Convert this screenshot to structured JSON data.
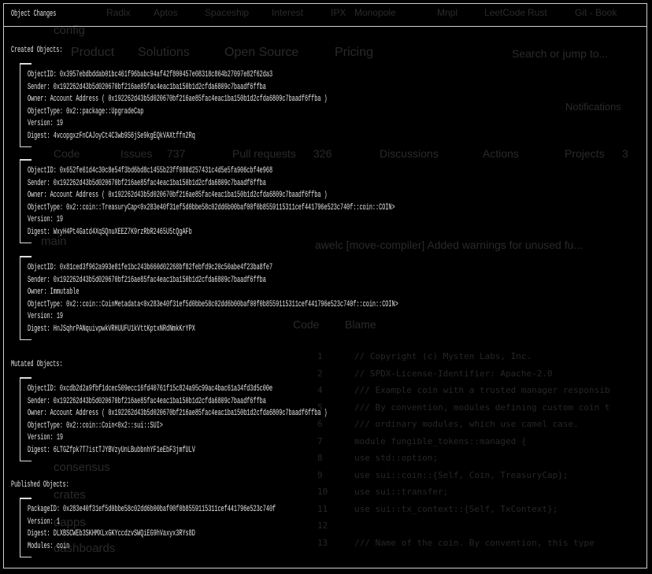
{
  "background": {
    "bookmarks": [
      "Radix",
      "Aptos",
      "Spaceship",
      "Interest",
      "IPX",
      "Monopole",
      "Mnpl",
      "LeetCode",
      "Rust",
      "Git - Book"
    ],
    "nav": [
      "Product",
      "Solutions",
      "Open Source",
      "Pricing"
    ],
    "search_placeholder": "Search or jump to...",
    "notifications": "Notifications",
    "tabs": [
      "Code",
      "Issues",
      "737",
      "Pull requests",
      "326",
      "Discussions",
      "Actions",
      "Projects",
      "3"
    ],
    "branch": "main",
    "commit": "awelc  [move-compiler] Added warnings for unused fu...",
    "code_tabs": [
      "Code",
      "Blame"
    ],
    "files": [
      "config",
      "consensus",
      "crates",
      "dapps",
      "dashboards"
    ],
    "code_lines": [
      {
        "n": "1",
        "t": "// Copyright (c) Mysten Labs, Inc."
      },
      {
        "n": "2",
        "t": "// SPDX-License-Identifier: Apache-2.0"
      },
      {
        "n": "4",
        "t": "/// Example coin with a trusted manager responsib"
      },
      {
        "n": "5",
        "t": "/// By convention, modules defining custom coin t"
      },
      {
        "n": "6",
        "t": "/// ordinary modules, which use camel case."
      },
      {
        "n": "7",
        "t": "module fungible_tokens::managed {"
      },
      {
        "n": "8",
        "t": "    use std::option;"
      },
      {
        "n": "9",
        "t": "    use sui::coin::{Self, Coin, TreasuryCap};"
      },
      {
        "n": "10",
        "t": "    use sui::transfer;"
      },
      {
        "n": "11",
        "t": "    use sui::tx_context::{Self, TxContext};"
      },
      {
        "n": "12",
        "t": ""
      },
      {
        "n": "13",
        "t": "    /// Name of the coin. By convention, this type"
      }
    ]
  },
  "title": "Object Changes",
  "sections": {
    "created_label": "Created Objects:",
    "mutated_label": "Mutated Objects:",
    "published_label": "Published Objects:"
  },
  "created": [
    [
      "ObjectID: 0x3957ebdbddab01bc461f96babc94af42f800457e08318c864b27097e82f62da3",
      "Sender: 0x192262d43b5d020670bf216ae85fac4eac1ba150b1d2cfda6809c7baadf6ffba",
      "Owner: Account Address ( 0x192262d43b5d020670bf216ae85fac4eac1ba150b1d2cfda6809c7baadf6ffba )",
      "ObjectType: 0x2::package::UpgradeCap",
      "Version: 19",
      "Digest: 4vcopgxzFnCAJoyCt4C3wb9S6jSe9kgEQkVAXtffn2Rq"
    ],
    [
      "ObjectID: 0x652fe61d4c30c8e54f3bd6bd8c1455b23ff088d257431c4d5e5fa906cbf4e968",
      "Sender: 0x192262d43b5d020670bf216ae85fac4eac1ba150b1d2cfda6809c7baadf6ffba",
      "Owner: Account Address ( 0x192262d43b5d020670bf216ae85fac4eac1ba150b1d2cfda6809c7baadf6ffba )",
      "ObjectType: 0x2::coin::TreasuryCap<0x283e40f31ef5d0bbe58c02dd6b00baf00f0b8559115311cef441796e523c740f::coin::COIN>",
      "Version: 19",
      "Digest: WxyH4Pt4Gatd4XqSQnuXEEZ7K9rzRbR2465U5tQgAFb"
    ],
    [
      "ObjectID: 0x81ced3f962a993e81fe1bc243b660d02268bf82febfd9c20c50abe4f23ba8fe7",
      "Sender: 0x192262d43b5d020670bf216ae85fac4eac1ba150b1d2cfda6809c7baadf6ffba",
      "Owner: Immutable",
      "ObjectType: 0x2::coin::CoinMetadata<0x283e40f31ef5d0bbe58c02dd6b00baf00f0b8559115311cef441796e523c740f::coin::COIN>",
      "Version: 19",
      "Digest: HnJSqhrPANquivpwkVRHUUFU1kVttKptxNRdNmkKrYPX"
    ]
  ],
  "mutated": [
    [
      "ObjectID: 0xcdb2d2a9fbf1dcec509ecc16fd40761f15c824a95c99ac4bac61a34fd3d5c00e",
      "Sender: 0x192262d43b5d020670bf216ae85fac4eac1ba150b1d2cfda6809c7baadf6ffba",
      "Owner: Account Address ( 0x192262d43b5d020670bf216ae85fac4eac1ba150b1d2cfda6809c7baadf6ffba )",
      "ObjectType: 0x2::coin::Coin<0x2::sui::SUI>",
      "Version: 19",
      "Digest: 6LTGZfpk7T7istTJYBVzyUnLBubbnhYF1eEbF3jmfULV"
    ]
  ],
  "published": [
    [
      "PackageID: 0x283e40f31ef5d0bbe58c02dd6b00baf00f0b8559115311cef441796e523c740f",
      "Version: 1",
      "Digest: DLXBSCWEb3SKHMXLxGKYccdzvSWQiEG9hVaxyx3RYs8D",
      "Modules: coin"
    ]
  ]
}
